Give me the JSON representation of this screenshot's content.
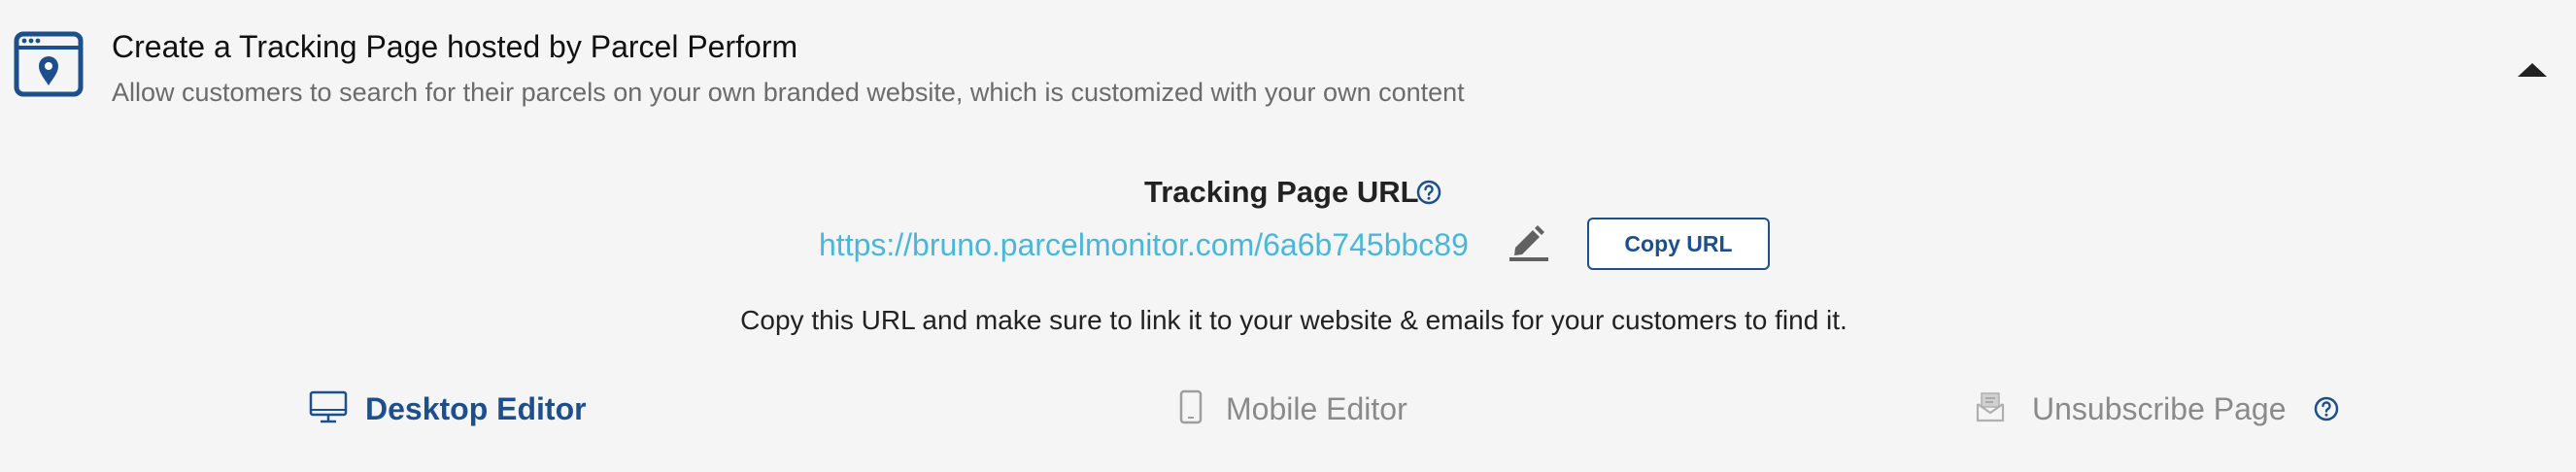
{
  "header": {
    "title": "Create a Tracking Page hosted by Parcel Perform",
    "subtitle": "Allow customers to search for their parcels on your own branded website, which is customized with your own content",
    "icon": "browser-location-icon",
    "toggle_icon": "caret-up-icon"
  },
  "tracking_url": {
    "heading": "Tracking Page URL",
    "url": "https://bruno.parcelmonitor.com/6a6b745bbc89",
    "copy_label": "Copy URL",
    "hint": "Copy this URL and make sure to link it to your website & emails for your customers to find it."
  },
  "tabs": [
    {
      "label": "Desktop Editor",
      "icon": "desktop-icon",
      "active": true
    },
    {
      "label": "Mobile Editor",
      "icon": "mobile-icon",
      "active": false
    },
    {
      "label": "Unsubscribe Page",
      "icon": "envelope-icon",
      "active": false
    }
  ],
  "colors": {
    "primary": "#1d4f8c",
    "link": "#4ab7d9",
    "muted": "#8a8a8a",
    "background": "#f5f5f5"
  }
}
